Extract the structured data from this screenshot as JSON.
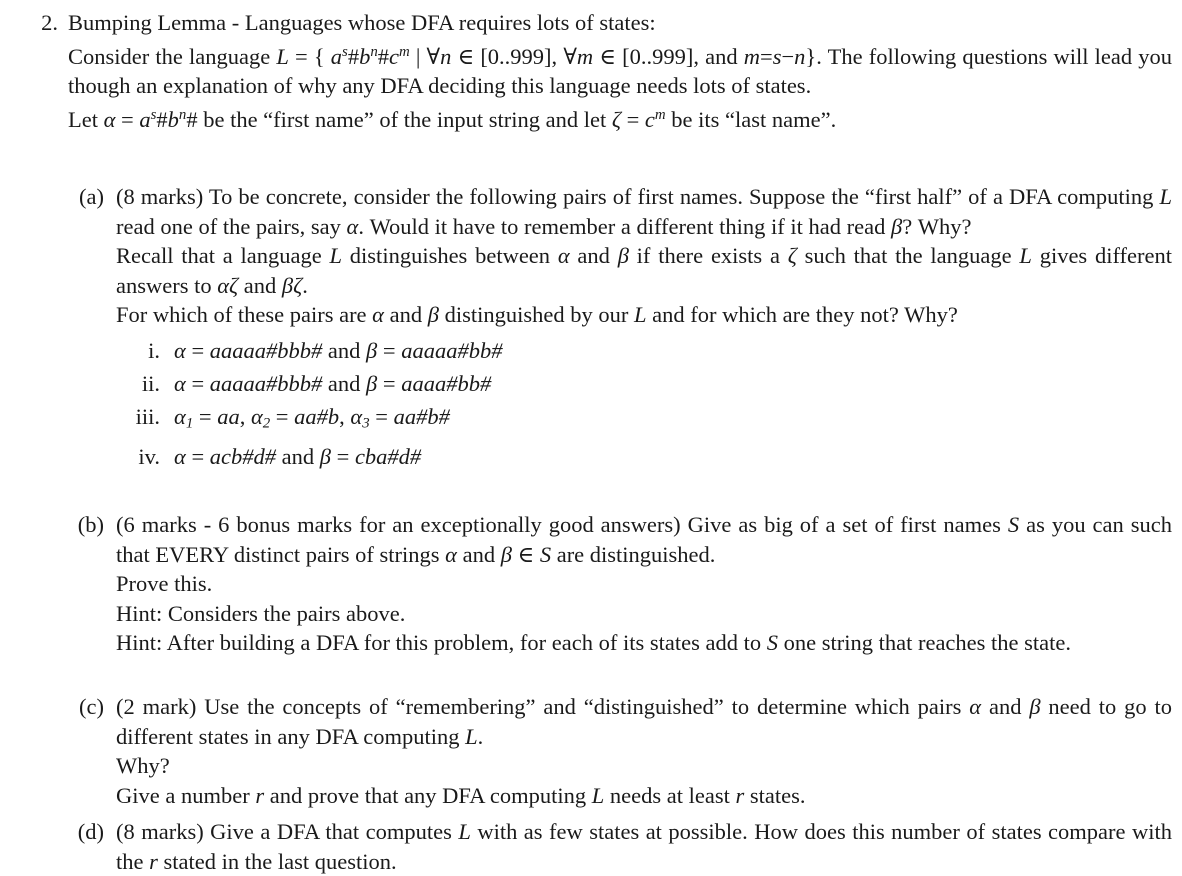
{
  "document": {
    "question_number": "2.",
    "title": "Bumping Lemma - Languages whose DFA requires lots of states:",
    "intro_line_1_pre": "Consider the language ",
    "intro_L": "L",
    "intro_eq": " = { ",
    "intro_lang_a": "a",
    "intro_lang_a_sup": "s",
    "intro_hash1": "#",
    "intro_lang_b": "b",
    "intro_lang_b_sup": "n",
    "intro_hash2": "#",
    "intro_lang_c": "c",
    "intro_lang_c_sup": "m",
    "intro_mid": " | ",
    "intro_forall_n": "∀n",
    "intro_in1": " ∈ ",
    "intro_range1": "[0..999],",
    "intro_forall_m": " ∀m",
    "intro_in2": " ∈ ",
    "intro_range2": "[0..999],",
    "intro_and": "  and ",
    "intro_m": "m",
    "intro_eq2": "=",
    "intro_s": "s",
    "intro_minus": "−",
    "intro_n": "n",
    "intro_close": "}. ",
    "intro_tail": "The following questions will lead you though an explanation of why any DFA deciding this language needs lots of states.",
    "let_line_pre": "Let ",
    "let_alpha": "α",
    "let_eq": " = ",
    "let_a": "a",
    "let_a_sup": "s",
    "let_hash1": "#",
    "let_b": "b",
    "let_b_sup": "n",
    "let_hash2": "#",
    "let_mid": " be the “first name” of the input string and let ",
    "let_zeta": "ζ",
    "let_eq2": " = ",
    "let_c": "c",
    "let_c_sup": "m",
    "let_tail": " be its “last name”."
  },
  "parts": [
    {
      "marker": "(a)",
      "marks": "(8 marks)",
      "text_1": " To be concrete, consider the following pairs of first names. Suppose the “first half” of a DFA computing ",
      "text_1_L": "L",
      "text_2": " read one of the pairs, say ",
      "text_2_alpha": "α",
      "text_3": ". Would it have to remember a different thing if it had read ",
      "text_3_beta": "β",
      "text_4": "? Why?",
      "recall_1": "Recall that a language ",
      "recall_L": "L",
      "recall_2": " distinguishes between ",
      "recall_alpha": "α",
      "recall_3": " and ",
      "recall_beta": "β",
      "recall_4": " if there exists a ",
      "recall_zeta": "ζ",
      "recall_5": " such that the language ",
      "recall_L2": "L",
      "recall_6": " gives different answers to ",
      "recall_az": "αζ",
      "recall_7": " and ",
      "recall_bz": "βζ",
      "recall_8": ".",
      "forwhich_1": "For which of these pairs are ",
      "forwhich_alpha": "α",
      "forwhich_2": " and ",
      "forwhich_beta": "β",
      "forwhich_3": " distinguished by our ",
      "forwhich_L": "L",
      "forwhich_4": " and for which are they not? Why?",
      "roman_items": [
        {
          "marker": "i.",
          "lhs_sym": "α",
          "lhs_eq": " = ",
          "lhs_val": "aaaaa#bbb#",
          "conj": " and ",
          "rhs_sym": "β",
          "rhs_eq": " = ",
          "rhs_val": "aaaaa#bb#"
        },
        {
          "marker": "ii.",
          "lhs_sym": "α",
          "lhs_eq": " = ",
          "lhs_val": "aaaaa#bbb#",
          "conj": " and ",
          "rhs_sym": "β",
          "rhs_eq": " = ",
          "rhs_val": "aaaa#bb#"
        },
        {
          "marker": "iii.",
          "a1_sym": "α",
          "a1_sub": "1",
          "a1_eq": " = ",
          "a1_val": "aa",
          "sep1": ", ",
          "a2_sym": "α",
          "a2_sub": "2",
          "a2_eq": " = ",
          "a2_val": "aa#b",
          "sep2": ", ",
          "a3_sym": "α",
          "a3_sub": "3",
          "a3_eq": " = ",
          "a3_val": "aa#b#"
        },
        {
          "marker": "iv.",
          "lhs_sym": "α",
          "lhs_eq": " = ",
          "lhs_val": "acb#d#",
          "conj": " and ",
          "rhs_sym": "β",
          "rhs_eq": " = ",
          "rhs_val": "cba#d#"
        }
      ]
    },
    {
      "marker": "(b)",
      "marks": "(6 marks - 6 bonus marks for an exceptionally good answers)",
      "text_1": " Give as big of a set of first names ",
      "text_S": "S",
      "text_2": " as you can such that EVERY distinct pairs of strings ",
      "text_alpha": "α",
      "text_3": " and ",
      "text_beta": "β",
      "text_in": " ∈ ",
      "text_S2": "S",
      "text_4": " are distinguished.",
      "prove": "Prove this.",
      "hint1": "Hint:  Considers the pairs above.",
      "hint2_1": "Hint:  After building a DFA for this problem, for each of its states add to ",
      "hint2_S": "S",
      "hint2_2": " one string that reaches the state."
    },
    {
      "marker": "(c)",
      "marks": "(2 mark)",
      "text_1": " Use the concepts of “remembering” and “distinguished” to determine which pairs ",
      "text_alpha": "α",
      "text_2": " and ",
      "text_beta": "β",
      "text_3": " need to go to different states in any DFA computing ",
      "text_L": "L",
      "text_4": ".",
      "why": "Why?",
      "give_1": "Give a number ",
      "give_r": "r",
      "give_2": " and prove that any DFA computing ",
      "give_L": "L",
      "give_3": " needs at least ",
      "give_r2": "r",
      "give_4": " states."
    },
    {
      "marker": "(d)",
      "marks": "(8 marks)",
      "text_1": " Give a DFA that computes ",
      "text_L": "L",
      "text_2": " with as few states at possible. How does this number of states compare with the ",
      "text_r": "r",
      "text_3": " stated in the last question."
    }
  ]
}
